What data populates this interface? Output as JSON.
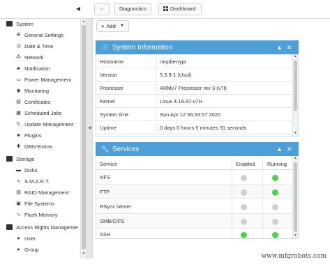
{
  "topbar": {
    "collapse_icon": "chevron-left-icon",
    "breadcrumbs": {
      "home_icon": "home-icon",
      "diagnostics": "Diagnostics",
      "dashboard": "Dashboard",
      "dashboard_icon": "dashboard-grid-icon"
    }
  },
  "sidebar": {
    "groups": [
      {
        "label": "System",
        "items": [
          {
            "label": "General Settings",
            "icon": "sliders-icon"
          },
          {
            "label": "Date & Time",
            "icon": "clock-icon"
          },
          {
            "label": "Network",
            "icon": "network-icon"
          },
          {
            "label": "Notification",
            "icon": "bell-icon"
          },
          {
            "label": "Power Management",
            "icon": "battery-icon"
          },
          {
            "label": "Monitoring",
            "icon": "monitor-icon"
          },
          {
            "label": "Certificates",
            "icon": "certificate-icon"
          },
          {
            "label": "Scheduled Jobs",
            "icon": "calendar-icon"
          },
          {
            "label": "Update Management",
            "icon": "refresh-icon"
          },
          {
            "label": "Plugins",
            "icon": "plug-icon"
          },
          {
            "label": "OMV-Extras",
            "icon": "extras-icon"
          }
        ]
      },
      {
        "label": "Storage",
        "items": [
          {
            "label": "Disks",
            "icon": "disk-icon"
          },
          {
            "label": "S.M.A.R.T.",
            "icon": "smart-icon"
          },
          {
            "label": "RAID Management",
            "icon": "raid-icon"
          },
          {
            "label": "File Systems",
            "icon": "filesystem-icon"
          },
          {
            "label": "Flash Memory",
            "icon": "flash-icon"
          }
        ]
      },
      {
        "label": "Access Rights Managemer",
        "items": [
          {
            "label": "User",
            "icon": "user-icon"
          },
          {
            "label": "Group",
            "icon": "group-icon"
          }
        ]
      }
    ]
  },
  "toolbar": {
    "add_label": "Add",
    "add_icon": "plus-icon",
    "dropdown_icon": "caret-down-icon"
  },
  "system_info": {
    "title": "System Information",
    "icon": "info-circle-icon",
    "rows": [
      {
        "key": "Hostname",
        "value": "raspberrypi"
      },
      {
        "key": "Version",
        "value": "5.3.9-1 (Usul)"
      },
      {
        "key": "Processor",
        "value": "ARMv7 Processor rev 3 (v7l)"
      },
      {
        "key": "Kernel",
        "value": "Linux 4.19.97-v7l+"
      },
      {
        "key": "System time",
        "value": "Sun Apr 12 06:33:57 2020"
      },
      {
        "key": "Uptime",
        "value": "0 days 0 hours 5 minutes 31 seconds"
      }
    ]
  },
  "services": {
    "title": "Services",
    "icon": "wrench-icon",
    "columns": {
      "service": "Service",
      "enabled": "Enabled",
      "running": "Running"
    },
    "rows": [
      {
        "name": "NFS",
        "enabled": false,
        "running": true
      },
      {
        "name": "FTP",
        "enabled": false,
        "running": true
      },
      {
        "name": "RSync server",
        "enabled": false,
        "running": false
      },
      {
        "name": "SMB/CIFS",
        "enabled": false,
        "running": false
      },
      {
        "name": "SSH",
        "enabled": true,
        "running": true
      }
    ]
  },
  "panel_controls": {
    "collapse_icon": "chevron-up-icon",
    "close_icon": "close-icon"
  },
  "watermark": "www.mfgrobots.com",
  "colors": {
    "panel_header": "#4d9fd8",
    "status_on": "#4cd24c",
    "status_off": "#cfcfcf"
  }
}
